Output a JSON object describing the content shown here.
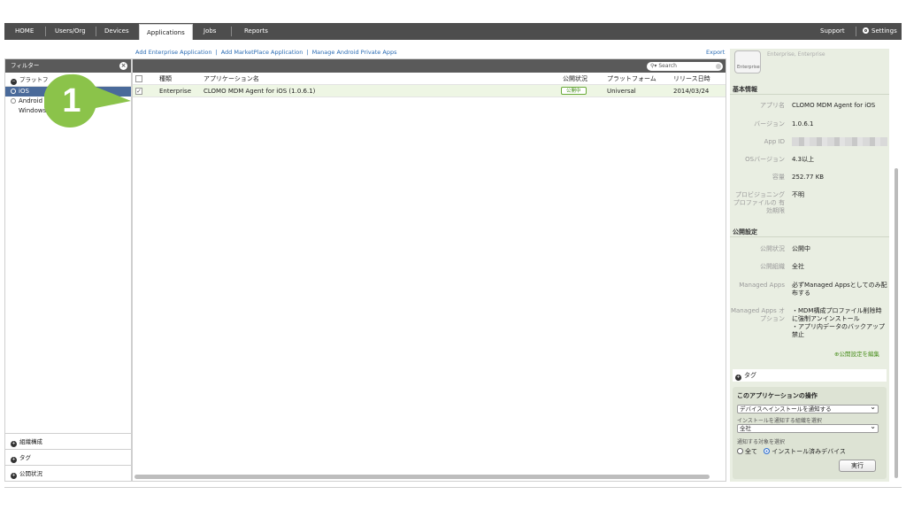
{
  "nav": {
    "home": "HOME",
    "users": "Users/Org",
    "devices": "Devices",
    "applications": "Applications",
    "jobs": "Jobs",
    "reports": "Reports",
    "support": "Support",
    "settings": "Settings"
  },
  "actions": {
    "add_enterprise": "Add Enterprise Application",
    "add_marketplace": "Add MarketPlace Application",
    "manage_android": "Manage Android Private Apps",
    "export": "Export",
    "sep": "|"
  },
  "filter": {
    "title": "フィルター",
    "platform": "プラットフ",
    "os_items": [
      "iOS",
      "Android",
      "Windows"
    ],
    "bottom": [
      "組織構成",
      "タグ",
      "公開状況"
    ]
  },
  "callout": {
    "number": "1"
  },
  "table": {
    "search_placeholder": "Search",
    "headers": {
      "type": "種類",
      "name": "アプリケーション名",
      "status": "公開状況",
      "platform": "プラットフォーム",
      "date": "リリース日時"
    },
    "rows": [
      {
        "checked": "✓",
        "type": "Enterprise",
        "name": "CLOMO MDM Agent for iOS (1.0.6.1)",
        "status": "公開中",
        "platform": "Universal",
        "date": "2014/03/24"
      }
    ]
  },
  "detail": {
    "icon_label": "Enterprise",
    "faded_text": "Enterprise, Enterprise",
    "basic_title": "基本情報",
    "basic": {
      "app_name_k": "アプリ名",
      "app_name_v": "CLOMO MDM Agent for iOS",
      "version_k": "バージョン",
      "version_v": "1.0.6.1",
      "app_id_k": "App ID",
      "os_k": "OSバージョン",
      "os_v": "4.3以上",
      "size_k": "容量",
      "size_v": "252.77 KB",
      "prov_k": "プロビジョニング プロファイルの 有効期限",
      "prov_v": "不明"
    },
    "public_title": "公開設定",
    "public": {
      "status_k": "公開状況",
      "status_v": "公開中",
      "org_k": "公開組織",
      "org_v": "全社",
      "managed_k": "Managed Apps",
      "managed_v": "必ずManaged Appsとしてのみ配布する",
      "managed_opt_k": "Managed Apps オプション",
      "managed_opt_v1": "・MDM構成プロファイル削除時に強制アンインストール",
      "managed_opt_v2": "・アプリ内データのバックアップ禁止"
    },
    "edit_link": "公開設定を編集",
    "tag": "タグ",
    "ops": {
      "title": "このアプリケーションの操作",
      "action_select": "デバイスへインストールを通知する",
      "org_label": "インストールを通知する組織を選択",
      "org_select": "全社",
      "target_label": "通知する対象を選択",
      "radio_all": "全て",
      "radio_installed": "インストール済みデバイス",
      "run": "実行"
    }
  }
}
